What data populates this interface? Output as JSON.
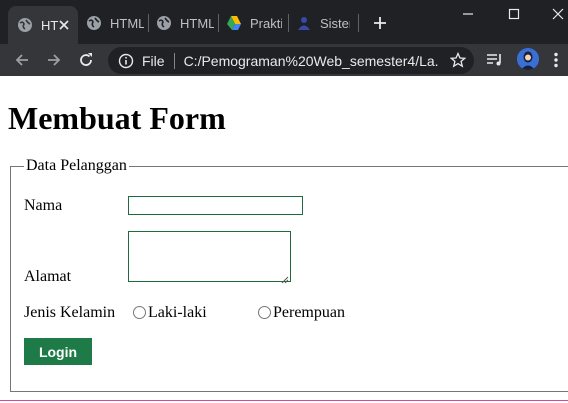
{
  "browser": {
    "tabs": [
      {
        "title": "HT",
        "icon": "globe-icon",
        "active": true
      },
      {
        "title": "HTML",
        "icon": "globe-icon",
        "active": false
      },
      {
        "title": "HTML",
        "icon": "globe-icon",
        "active": false
      },
      {
        "title": "Prakti",
        "icon": "google-drive-icon",
        "active": false
      },
      {
        "title": "Sister",
        "icon": "person-badge-icon",
        "active": false
      }
    ],
    "new_tab_icon": "plus-icon",
    "window_controls": [
      "minimize-icon",
      "maximize-icon",
      "close-icon"
    ],
    "nav_icons": [
      "back-arrow-icon",
      "forward-arrow-icon",
      "reload-icon"
    ],
    "address": {
      "scheme_label": "File",
      "url": "C:/Pemograman%20Web_semester4/La..."
    },
    "toolbar_icons": [
      "star-icon",
      "media-queue-icon",
      "profile-avatar",
      "kebab-menu-icon"
    ],
    "colors": {
      "chrome_dark": "#202124",
      "chrome_mid": "#35363a"
    }
  },
  "page": {
    "heading": "Membuat Form",
    "fieldset": {
      "legend": "Data Pelanggan",
      "nama_label": "Nama",
      "nama_value": "",
      "alamat_label": "Alamat",
      "alamat_value": "",
      "gender_label": "Jenis Kelamin",
      "gender_options": [
        "Laki-laki",
        "Perempuan"
      ],
      "login_label": "Login"
    },
    "colors": {
      "button_bg": "#1e7a46",
      "input_border": "#1f6b3f",
      "bottom_rule": "#d04ca0"
    }
  }
}
